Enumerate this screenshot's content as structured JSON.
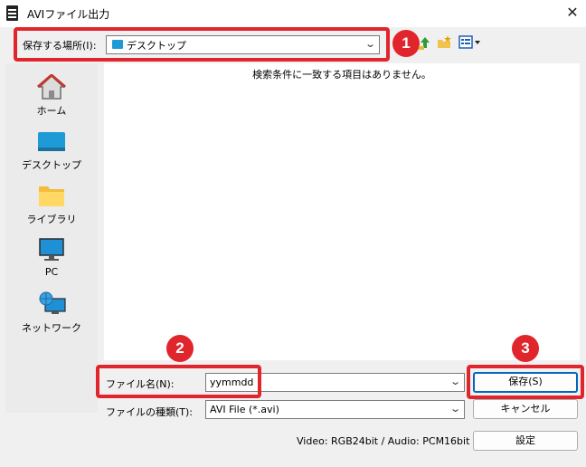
{
  "window": {
    "title": "AVIファイル出力",
    "close_glyph": "✕"
  },
  "location": {
    "label": "保存する場所(I):",
    "value": "デスクトップ"
  },
  "places": [
    {
      "label": "ホーム",
      "icon": "home-icon"
    },
    {
      "label": "デスクトップ",
      "icon": "desktop-icon"
    },
    {
      "label": "ライブラリ",
      "icon": "library-folder-icon"
    },
    {
      "label": "PC",
      "icon": "pc-icon"
    },
    {
      "label": "ネットワーク",
      "icon": "network-icon"
    }
  ],
  "filelist": {
    "empty_message": "検索条件に一致する項目はありません。"
  },
  "filename": {
    "label": "ファイル名(N):",
    "value": "yymmdd"
  },
  "filetype": {
    "label": "ファイルの種類(T):",
    "value": "AVI File (*.avi)"
  },
  "buttons": {
    "save": "保存(S)",
    "cancel": "キャンセル",
    "settings": "設定"
  },
  "status": "Video: RGB24bit / Audio: PCM16bit",
  "badges": [
    "1",
    "2",
    "3"
  ],
  "colors": {
    "callout": "#e0262c",
    "accent": "#0067c0"
  }
}
